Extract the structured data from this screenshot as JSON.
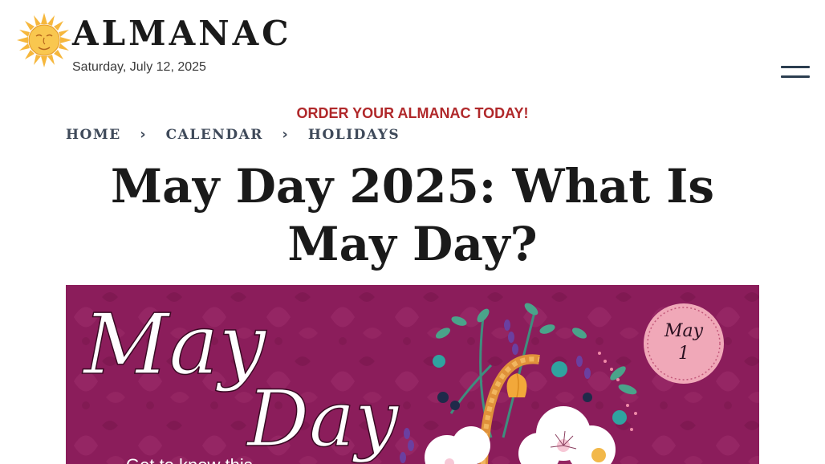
{
  "header": {
    "brand": "ALMANAC",
    "date": "Saturday, July 12, 2025",
    "logo_icon": "sun-face-icon",
    "menu_icon": "hamburger-menu-icon"
  },
  "promo": {
    "text": "ORDER YOUR ALMANAC TODAY!",
    "color": "#b0282a"
  },
  "breadcrumb": {
    "items": [
      "HOME",
      "CALENDAR",
      "HOLIDAYS"
    ],
    "separator_icon": "chevron-right-icon"
  },
  "article": {
    "title": "May Day 2025: What Is May Day?"
  },
  "hero": {
    "script_line1": "May",
    "script_line2": "Day",
    "badge_month": "May",
    "badge_day": "1",
    "caption_partial": "Get to know this",
    "background_color": "#8b1d5b",
    "badge_color": "#f0a8b8"
  }
}
